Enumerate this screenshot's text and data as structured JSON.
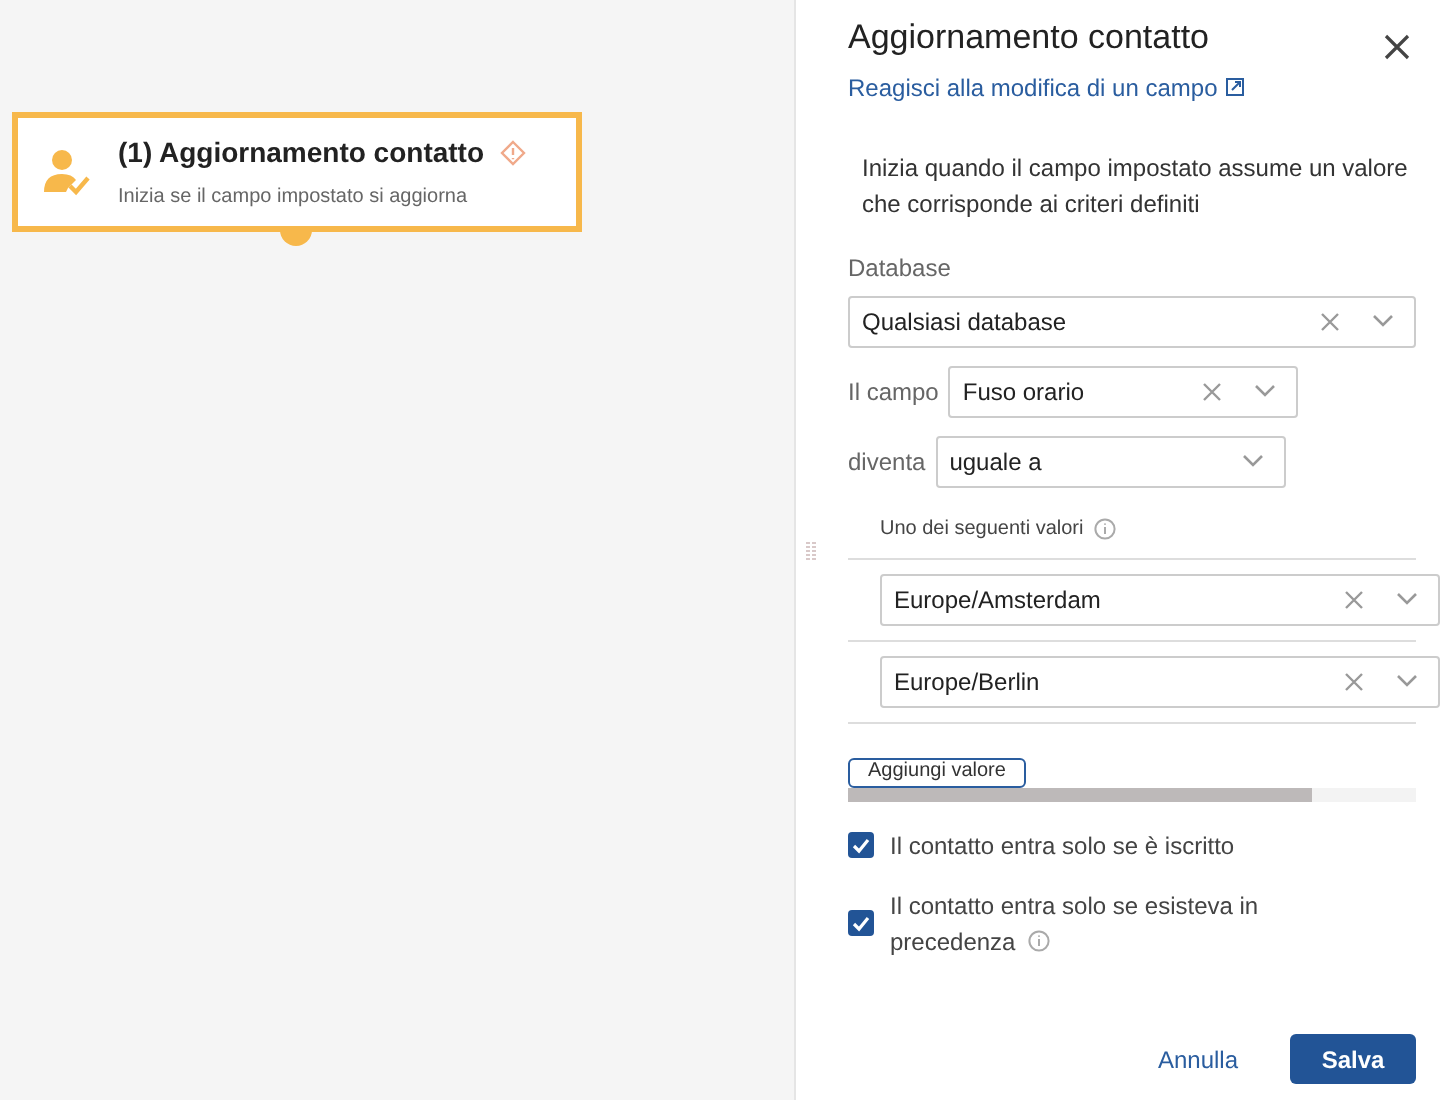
{
  "node": {
    "title": "(1) Aggiornamento contatto",
    "subtitle": "Inizia se il campo impostato si aggiorna",
    "selected": true
  },
  "panel": {
    "title": "Aggiornamento contatto",
    "link": "Reagisci alla modifica di un campo",
    "description": "Inizia quando il campo impostato assume un valore che corrisponde ai criteri definiti",
    "database": {
      "label": "Database",
      "value": "Qualsiasi database"
    },
    "field": {
      "label": "Il campo",
      "value": "Fuso orario"
    },
    "operator": {
      "label": "diventa",
      "value": "uguale a"
    },
    "values_label": "Uno dei seguenti valori",
    "values": [
      "Europe/Amsterdam",
      "Europe/Berlin"
    ],
    "add_button": "Aggiungi valore",
    "options": [
      {
        "label": "Il contatto entra solo se è iscritto",
        "checked": true,
        "info": false
      },
      {
        "label": "Il contatto entra solo se esisteva in precedenza",
        "checked": true,
        "info": true
      }
    ],
    "cancel": "Annulla",
    "save": "Salva"
  }
}
